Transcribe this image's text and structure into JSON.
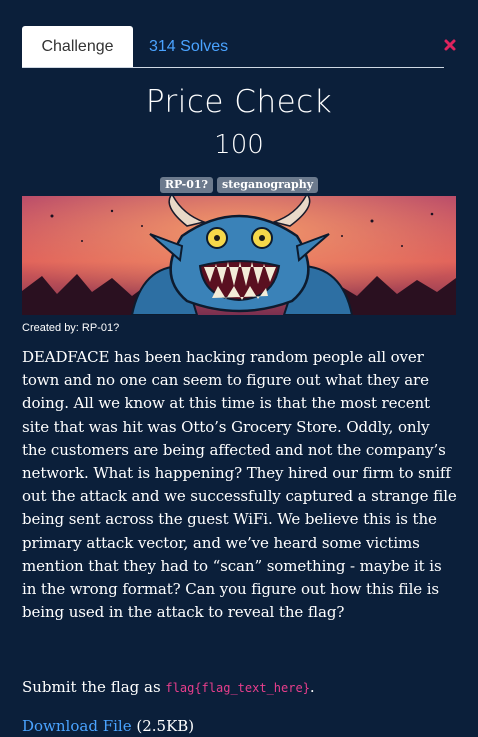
{
  "tabs": {
    "challenge_label": "Challenge",
    "solves_label": "314 Solves"
  },
  "challenge": {
    "title": "Price Check",
    "points": "100",
    "tags": [
      "RP-01?",
      "steganography"
    ],
    "created_by": "Created by: RP-01?",
    "description": "DEADFACE has been hacking random people all over town and no one can seem to figure out what they are doing. All we know at this time is that the most recent site that was hit was Otto’s Grocery Store. Oddly, only the customers are being affected and not the company’s network. What is happening? They hired our firm to sniff out the attack and we successfully captured a strange file being sent across the guest WiFi. We believe this is the primary attack vector, and we’ve heard some victims mention that they had to “scan” something - maybe it is in the wrong format? Can you figure out how this file is being used in the attack to reveal the flag?",
    "submit_prefix": "Submit the flag as ",
    "flag_format": "flag{flag_text_here}",
    "submit_suffix": ".",
    "download_label": "Download File",
    "download_size": "(2.5KB)"
  },
  "colors": {
    "background": "#0b1f3a",
    "link": "#4aa3ff",
    "code": "#e83e8c",
    "tag": "#6c7a8d",
    "close": "#e0245e"
  },
  "icons": [
    "close-icon"
  ]
}
